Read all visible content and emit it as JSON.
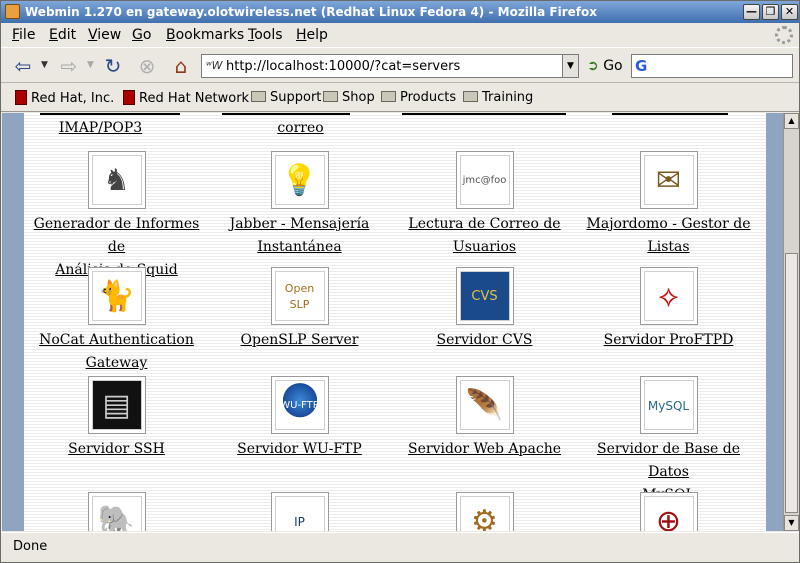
{
  "window": {
    "title": "Webmin 1.270 en gateway.olotwireless.net (Redhat Linux Fedora 4) - Mozilla Firefox",
    "controls": [
      "✕",
      "❐",
      "—"
    ]
  },
  "menubar": {
    "items": [
      {
        "key": "F",
        "rest": "ile"
      },
      {
        "key": "E",
        "rest": "dit"
      },
      {
        "key": "V",
        "rest": "iew"
      },
      {
        "key": "G",
        "rest": "o"
      },
      {
        "key": "B",
        "rest": "ookmarks"
      },
      {
        "key": "T",
        "rest": "ools"
      },
      {
        "key": "H",
        "rest": "elp"
      }
    ]
  },
  "navbar": {
    "url": "http://localhost:10000/?cat=servers",
    "go_label": "Go",
    "search_value": ""
  },
  "bookmarks": {
    "items": [
      {
        "label": "Red Hat, Inc.",
        "icon": "redhat-icon"
      },
      {
        "label": "Red Hat Network",
        "icon": "redhat-icon"
      },
      {
        "label": "Support",
        "icon": "folder-icon"
      },
      {
        "label": "Shop",
        "icon": "folder-icon"
      },
      {
        "label": "Products",
        "icon": "folder-icon"
      },
      {
        "label": "Training",
        "icon": "folder-icon"
      }
    ]
  },
  "modules": {
    "row0": [
      {
        "line1": "IMAP/POP3",
        "line2": ""
      },
      {
        "line1": "correo",
        "line2": ""
      }
    ],
    "row1": [
      {
        "line1": "Generador de Informes de",
        "line2": "Análisis de Squid",
        "glyph": "♞"
      },
      {
        "line1": "Jabber - Mensajería",
        "line2": "Instantánea",
        "glyph": "💡"
      },
      {
        "line1": "Lectura de Correo de",
        "line2": "Usuarios",
        "glyph": "jmc@foo"
      },
      {
        "line1": "Majordomo - Gestor de",
        "line2": "Listas",
        "glyph": "✉"
      }
    ],
    "row2": [
      {
        "line1": "NoCat Authentication",
        "line2": "Gateway",
        "glyph": "🐈"
      },
      {
        "line1": "OpenSLP Server",
        "line2": "",
        "glyph": "Open SLP"
      },
      {
        "line1": "Servidor CVS",
        "line2": "",
        "glyph": "CVS"
      },
      {
        "line1": "Servidor ProFTPD",
        "line2": "",
        "glyph": "⟡"
      }
    ],
    "row3": [
      {
        "line1": "Servidor SSH",
        "line2": "",
        "glyph": "▤"
      },
      {
        "line1": "Servidor WU-FTP",
        "line2": "",
        "glyph": "WU-FTP"
      },
      {
        "line1": "Servidor Web Apache",
        "line2": "",
        "glyph": "🪶"
      },
      {
        "line1": "Servidor de Base de Datos",
        "line2": "MySQL",
        "glyph": "MySQL"
      }
    ],
    "row4": [
      {
        "glyph": "🐘"
      },
      {
        "glyph": "IP"
      },
      {
        "glyph": "⚙"
      },
      {
        "glyph": "⊕"
      }
    ]
  },
  "status": {
    "text": "Done"
  }
}
